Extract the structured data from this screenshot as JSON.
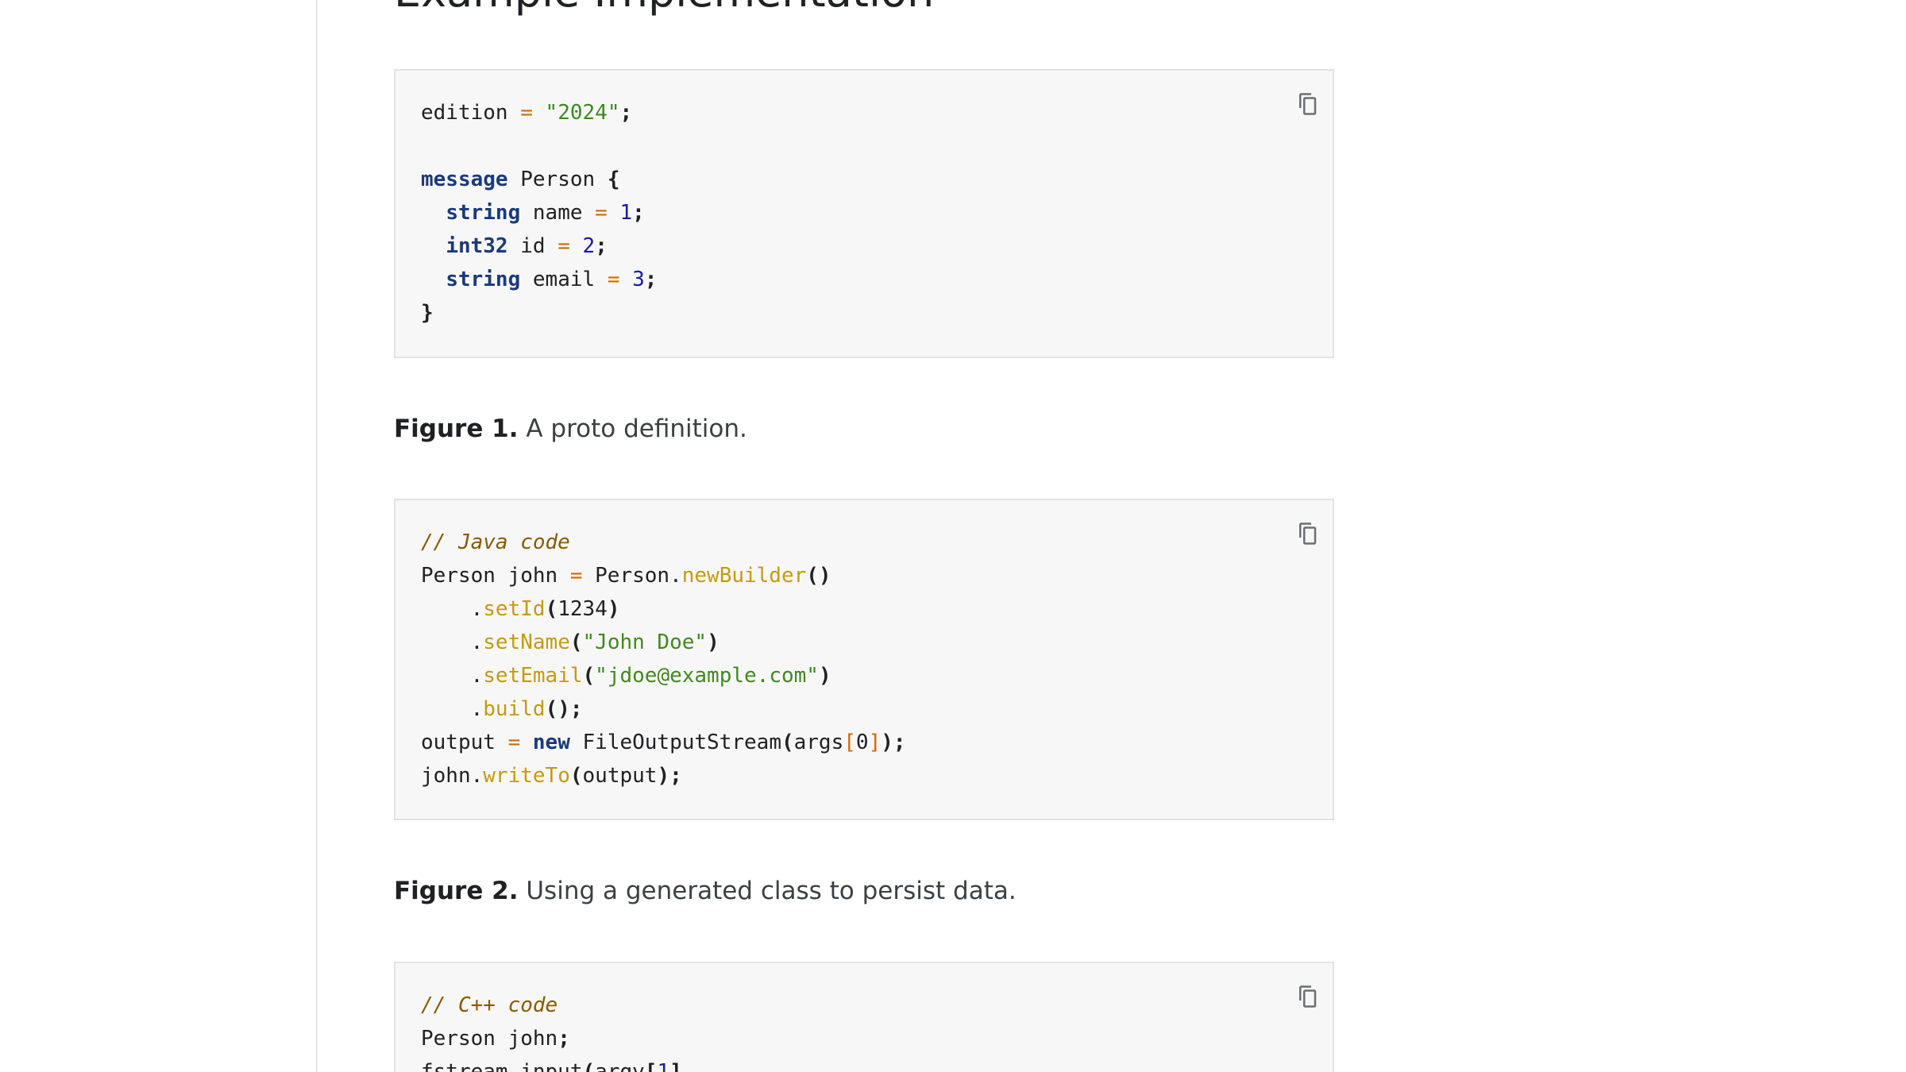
{
  "page": {
    "section_heading": "Example Implementation"
  },
  "colors": {
    "keyword": "#1a3a7c",
    "string": "#3f8a1e",
    "number": "#1a1aa6",
    "operator": "#d06a00",
    "method": "#c59a12",
    "comment": "#8a5a00",
    "code_background": "#f7f7f7"
  },
  "copy_icon": "copy-icon",
  "blocks": [
    {
      "lines": [
        [
          [
            "plain",
            "edition "
          ],
          [
            "op",
            "="
          ],
          [
            "plain",
            " "
          ],
          [
            "str",
            "\"2024\""
          ],
          [
            "pun",
            ";"
          ]
        ],
        [],
        [
          [
            "kw",
            "message"
          ],
          [
            "plain",
            " Person "
          ],
          [
            "pun",
            "{"
          ]
        ],
        [
          [
            "plain",
            "  "
          ],
          [
            "kw",
            "string"
          ],
          [
            "plain",
            " name "
          ],
          [
            "op",
            "="
          ],
          [
            "plain",
            " "
          ],
          [
            "num",
            "1"
          ],
          [
            "pun",
            ";"
          ]
        ],
        [
          [
            "plain",
            "  "
          ],
          [
            "kw",
            "int32"
          ],
          [
            "plain",
            " id "
          ],
          [
            "op",
            "="
          ],
          [
            "plain",
            " "
          ],
          [
            "num",
            "2"
          ],
          [
            "pun",
            ";"
          ]
        ],
        [
          [
            "plain",
            "  "
          ],
          [
            "kw",
            "string"
          ],
          [
            "plain",
            " email "
          ],
          [
            "op",
            "="
          ],
          [
            "plain",
            " "
          ],
          [
            "num",
            "3"
          ],
          [
            "pun",
            ";"
          ]
        ],
        [
          [
            "pun",
            "}"
          ]
        ]
      ]
    },
    {
      "lines": [
        [
          [
            "com",
            "// Java code"
          ]
        ],
        [
          [
            "plain",
            "Person john "
          ],
          [
            "op",
            "="
          ],
          [
            "plain",
            " Person."
          ],
          [
            "fn",
            "newBuilder"
          ],
          [
            "pun",
            "()"
          ]
        ],
        [
          [
            "plain",
            "    ."
          ],
          [
            "fn",
            "setId"
          ],
          [
            "pun",
            "("
          ],
          [
            "plain",
            "1234"
          ],
          [
            "pun",
            ")"
          ]
        ],
        [
          [
            "plain",
            "    ."
          ],
          [
            "fn",
            "setName"
          ],
          [
            "pun",
            "("
          ],
          [
            "str",
            "\"John Doe\""
          ],
          [
            "pun",
            ")"
          ]
        ],
        [
          [
            "plain",
            "    ."
          ],
          [
            "fn",
            "setEmail"
          ],
          [
            "pun",
            "("
          ],
          [
            "str",
            "\"jdoe@example.com\""
          ],
          [
            "pun",
            ")"
          ]
        ],
        [
          [
            "plain",
            "    ."
          ],
          [
            "fn",
            "build"
          ],
          [
            "pun",
            "();"
          ]
        ],
        [
          [
            "plain",
            "output "
          ],
          [
            "op",
            "="
          ],
          [
            "plain",
            " "
          ],
          [
            "kw",
            "new"
          ],
          [
            "plain",
            " FileOutputStream"
          ],
          [
            "pun",
            "("
          ],
          [
            "plain",
            "args"
          ],
          [
            "op",
            "["
          ],
          [
            "idx",
            "0"
          ],
          [
            "op",
            "]"
          ],
          [
            "pun",
            ");"
          ]
        ],
        [
          [
            "plain",
            "john."
          ],
          [
            "fn",
            "writeTo"
          ],
          [
            "pun",
            "("
          ],
          [
            "plain",
            "output"
          ],
          [
            "pun",
            ");"
          ]
        ]
      ]
    },
    {
      "lines": [
        [
          [
            "com",
            "// C++ code"
          ]
        ],
        [
          [
            "plain",
            "Person john"
          ],
          [
            "pun",
            ";"
          ]
        ],
        [
          [
            "plain",
            "fstream input"
          ],
          [
            "pun",
            "("
          ],
          [
            "plain",
            "argv"
          ],
          [
            "pun",
            "["
          ],
          [
            "num",
            "1"
          ],
          [
            "pun",
            "],"
          ]
        ]
      ]
    }
  ],
  "captions": [
    {
      "label": "Figure 1.",
      "text": " A proto definition."
    },
    {
      "label": "Figure 2.",
      "text": " Using a generated class to persist data."
    }
  ]
}
